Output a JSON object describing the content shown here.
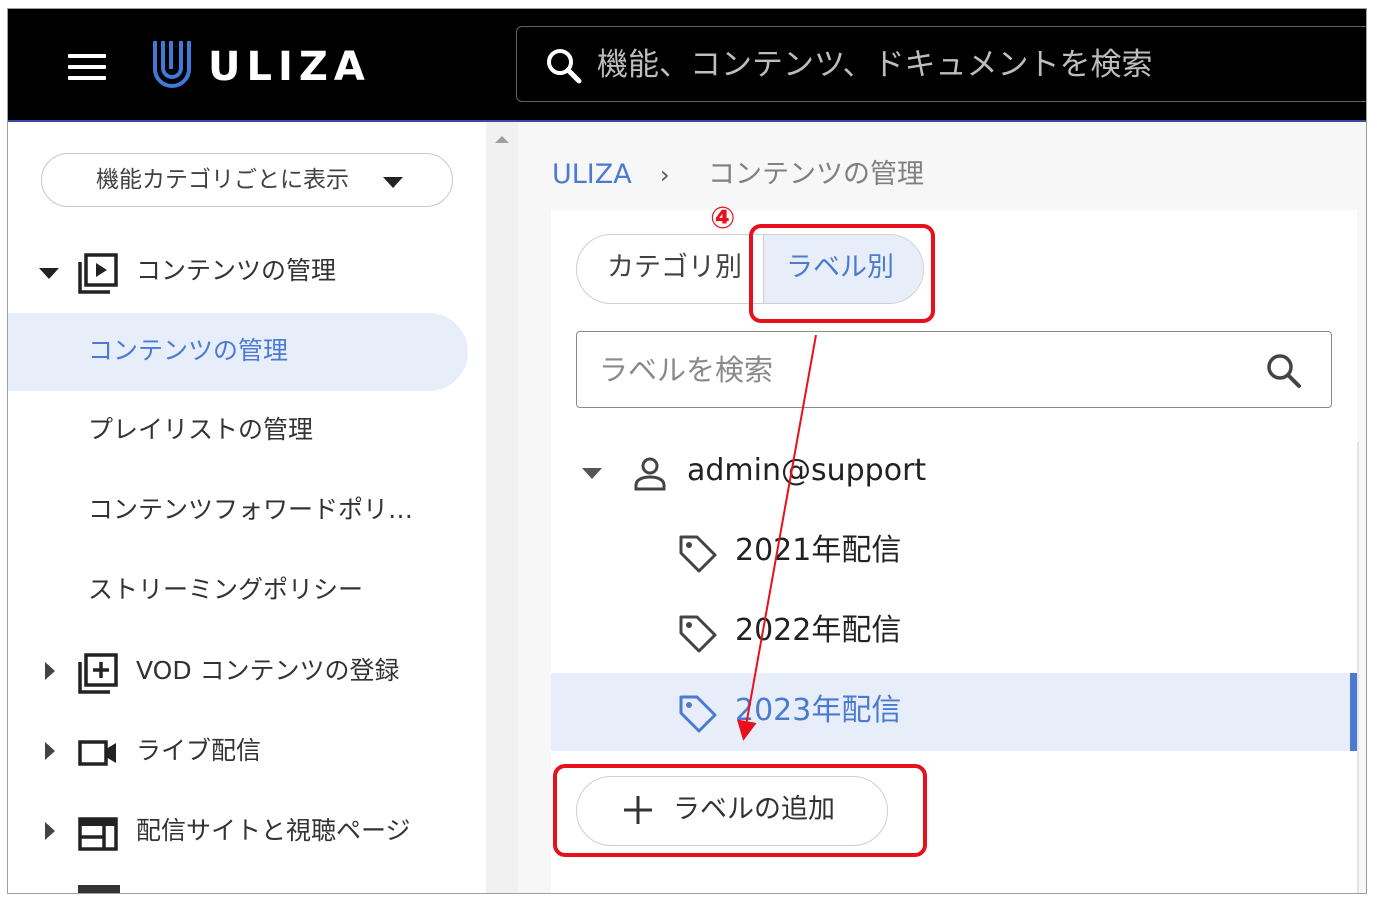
{
  "header": {
    "logo_text": "ULIZA",
    "search_placeholder": "機能、コンテンツ、ドキュメントを検索"
  },
  "sidebar": {
    "filter_label": "機能カテゴリごとに表示",
    "groups": [
      {
        "label": "コンテンツの管理",
        "expanded": true,
        "icon": "play-box-icon"
      },
      {
        "label": "VOD コンテンツの登録",
        "expanded": false,
        "icon": "add-box-icon"
      },
      {
        "label": "ライブ配信",
        "expanded": false,
        "icon": "video-camera-icon"
      },
      {
        "label": "配信サイトと視聴ページ",
        "expanded": false,
        "icon": "web-layout-icon"
      }
    ],
    "items": [
      {
        "label": "コンテンツの管理",
        "active": true
      },
      {
        "label": "プレイリストの管理",
        "active": false
      },
      {
        "label": "コンテンツフォワードポリ…",
        "active": false
      },
      {
        "label": "ストリーミングポリシー",
        "active": false
      }
    ]
  },
  "breadcrumb": {
    "home": "ULIZA",
    "separator": "›",
    "current": "コンテンツの管理"
  },
  "panel": {
    "tabs": [
      {
        "label": "カテゴリ別",
        "selected": false
      },
      {
        "label": "ラベル別",
        "selected": true
      }
    ],
    "label_search_placeholder": "ラベルを検索",
    "owner": "admin@support",
    "labels": [
      {
        "label": "2021年配信",
        "selected": false
      },
      {
        "label": "2022年配信",
        "selected": false
      },
      {
        "label": "2023年配信",
        "selected": true
      }
    ],
    "add_label_button": "ラベルの追加"
  },
  "annotation": {
    "step_number": "④",
    "color": "#e8101c"
  },
  "colors": {
    "accent": "#4a7bd0",
    "active_bg": "#e8eef9",
    "header_bg": "#000000",
    "highlight": "#e8101c"
  }
}
